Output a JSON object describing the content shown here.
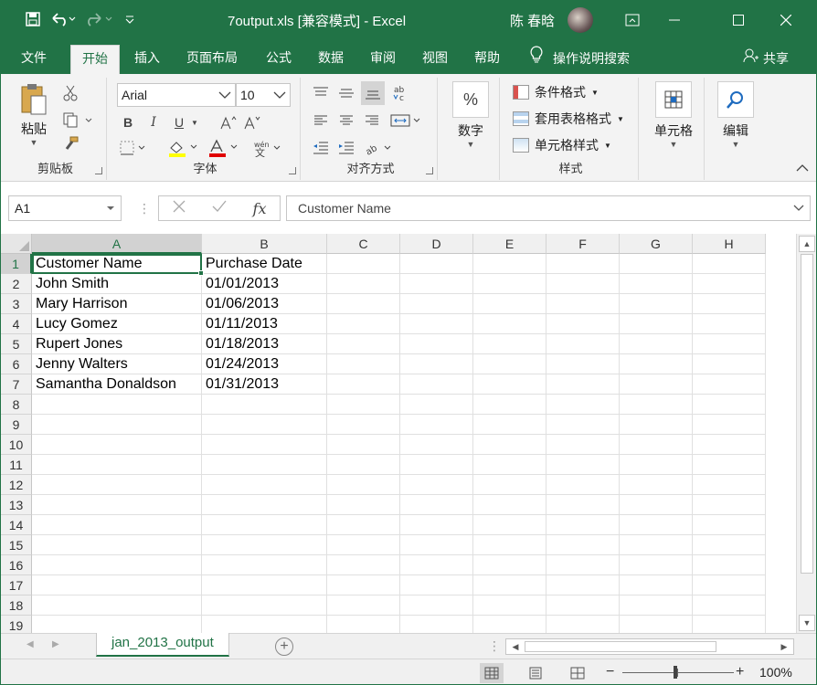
{
  "titlebar": {
    "title": "7output.xls  [兼容模式]  -  Excel",
    "user": "陈 春晗",
    "save_icon": "save-icon",
    "undo_icon": "undo-icon",
    "redo_icon": "redo-icon"
  },
  "tabs": [
    {
      "label": "文件"
    },
    {
      "label": "开始"
    },
    {
      "label": "插入"
    },
    {
      "label": "页面布局"
    },
    {
      "label": "公式"
    },
    {
      "label": "数据"
    },
    {
      "label": "审阅"
    },
    {
      "label": "视图"
    },
    {
      "label": "帮助"
    }
  ],
  "tell_me": "操作说明搜索",
  "share": "共享",
  "ribbon": {
    "clipboard": {
      "label": "剪贴板",
      "paste": "粘贴"
    },
    "font": {
      "label": "字体",
      "name": "Arial",
      "size": "10",
      "bold": "B",
      "italic": "I",
      "underline": "U"
    },
    "alignment": {
      "label": "对齐方式"
    },
    "number": {
      "label": "数字",
      "icon_text": "%"
    },
    "styles": {
      "label": "样式",
      "conditional": "条件格式",
      "table": "套用表格格式",
      "cell_styles": "单元格样式"
    },
    "cells": {
      "label": "单元格"
    },
    "editing": {
      "label": "编辑"
    }
  },
  "formula_bar": {
    "name_box": "A1",
    "fx": "fx",
    "content": "Customer Name"
  },
  "grid": {
    "columns": [
      "A",
      "B",
      "C",
      "D",
      "E",
      "F",
      "G",
      "H"
    ],
    "rows": [
      "1",
      "2",
      "3",
      "4",
      "5",
      "6",
      "7",
      "8",
      "9",
      "10",
      "11",
      "12",
      "13",
      "14",
      "15",
      "16",
      "17",
      "18",
      "19"
    ],
    "data": [
      [
        "Customer Name",
        "Purchase Date"
      ],
      [
        "John Smith",
        "01/01/2013"
      ],
      [
        "Mary Harrison",
        "01/06/2013"
      ],
      [
        "Lucy Gomez",
        "01/11/2013"
      ],
      [
        "Rupert Jones",
        "01/18/2013"
      ],
      [
        "Jenny Walters",
        "01/24/2013"
      ],
      [
        "Samantha Donaldson",
        "01/31/2013"
      ]
    ]
  },
  "sheet": {
    "name": "jan_2013_output",
    "add": "+"
  },
  "status": {
    "zoom": "100%",
    "zoom_minus": "−",
    "zoom_plus": "+"
  },
  "colors": {
    "brand": "#217346",
    "ribbon_bg": "#f3f3f3"
  }
}
